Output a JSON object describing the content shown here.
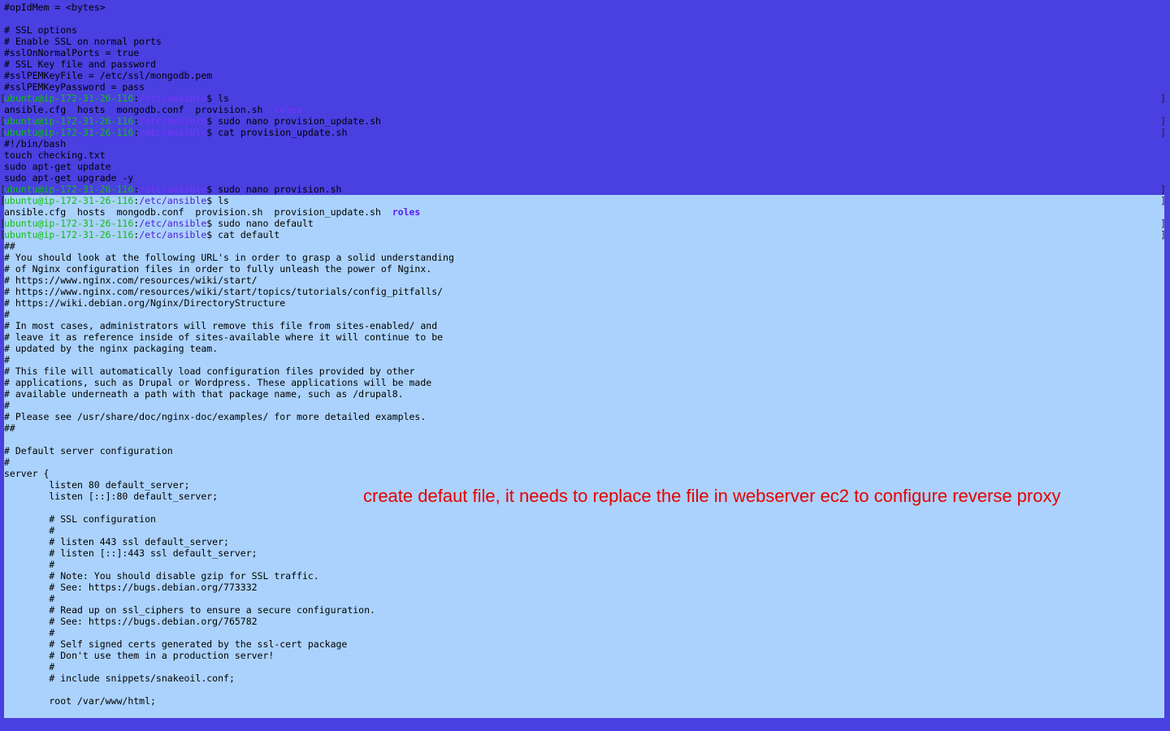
{
  "terminal": {
    "user_host": "ubuntu@ip-172-31-26-116",
    "path": "/etc/ansible",
    "colors": {
      "background": "#4a3fe0",
      "selection": "#abd2fc",
      "prompt_user": "#0fbf12",
      "prompt_path": "#7a33ff",
      "annotation": "#e60000"
    },
    "lines": [
      {
        "type": "text",
        "text": "#opIdMem = <bytes>"
      },
      {
        "type": "text",
        "text": ""
      },
      {
        "type": "text",
        "text": "# SSL options"
      },
      {
        "type": "text",
        "text": "# Enable SSL on normal ports"
      },
      {
        "type": "text",
        "text": "#sslOnNormalPorts = true"
      },
      {
        "type": "text",
        "text": "# SSL Key file and password"
      },
      {
        "type": "text",
        "text": "#sslPEMKeyFile = /etc/ssl/mongodb.pem"
      },
      {
        "type": "text",
        "text": "#sslPEMKeyPassword = pass"
      },
      {
        "type": "prompt",
        "user": "ubuntu@ip-172-31-26-116",
        "path": "/etc/ansible",
        "cmd": "$ ls",
        "selected": false
      },
      {
        "type": "ls",
        "text": "ansible.cfg  hosts  mongodb.conf  provision.sh  ",
        "roles": "roles",
        "selected": false
      },
      {
        "type": "prompt",
        "user": "ubuntu@ip-172-31-26-116",
        "path": "/etc/ansible",
        "cmd": "$ sudo nano provision_update.sh",
        "selected": false
      },
      {
        "type": "prompt",
        "user": "ubuntu@ip-172-31-26-116",
        "path": "/etc/ansible",
        "cmd": "$ cat provision_update.sh",
        "selected": false
      },
      {
        "type": "text",
        "text": "#!/bin/bash"
      },
      {
        "type": "text",
        "text": "touch checking.txt"
      },
      {
        "type": "text",
        "text": "sudo apt-get update"
      },
      {
        "type": "text",
        "text": "sudo apt-get upgrade -y"
      },
      {
        "type": "prompt",
        "user": "ubuntu@ip-172-31-26-116",
        "path": "/etc/ansible",
        "cmd": "$ sudo nano provision.sh",
        "selected": false
      },
      {
        "type": "prompt",
        "user": "ubuntu@ip-172-31-26-116",
        "path": "/etc/ansible",
        "cmd": "$ ls",
        "selected": true
      },
      {
        "type": "ls",
        "text": "ansible.cfg  hosts  mongodb.conf  provision.sh  provision_update.sh  ",
        "roles": "roles",
        "selected": true
      },
      {
        "type": "prompt",
        "user": "ubuntu@ip-172-31-26-116",
        "path": "/etc/ansible",
        "cmd": "$ sudo nano default",
        "selected": true
      },
      {
        "type": "prompt",
        "user": "ubuntu@ip-172-31-26-116",
        "path": "/etc/ansible",
        "cmd": "$ cat default",
        "selected": true
      },
      {
        "type": "text",
        "text": "##"
      },
      {
        "type": "text",
        "text": "# You should look at the following URL's in order to grasp a solid understanding"
      },
      {
        "type": "text",
        "text": "# of Nginx configuration files in order to fully unleash the power of Nginx."
      },
      {
        "type": "text",
        "text": "# https://www.nginx.com/resources/wiki/start/"
      },
      {
        "type": "text",
        "text": "# https://www.nginx.com/resources/wiki/start/topics/tutorials/config_pitfalls/"
      },
      {
        "type": "text",
        "text": "# https://wiki.debian.org/Nginx/DirectoryStructure"
      },
      {
        "type": "text",
        "text": "#"
      },
      {
        "type": "text",
        "text": "# In most cases, administrators will remove this file from sites-enabled/ and"
      },
      {
        "type": "text",
        "text": "# leave it as reference inside of sites-available where it will continue to be"
      },
      {
        "type": "text",
        "text": "# updated by the nginx packaging team."
      },
      {
        "type": "text",
        "text": "#"
      },
      {
        "type": "text",
        "text": "# This file will automatically load configuration files provided by other"
      },
      {
        "type": "text",
        "text": "# applications, such as Drupal or Wordpress. These applications will be made"
      },
      {
        "type": "text",
        "text": "# available underneath a path with that package name, such as /drupal8."
      },
      {
        "type": "text",
        "text": "#"
      },
      {
        "type": "text",
        "text": "# Please see /usr/share/doc/nginx-doc/examples/ for more detailed examples."
      },
      {
        "type": "text",
        "text": "##"
      },
      {
        "type": "text",
        "text": ""
      },
      {
        "type": "text",
        "text": "# Default server configuration"
      },
      {
        "type": "text",
        "text": "#"
      },
      {
        "type": "text",
        "text": "server {"
      },
      {
        "type": "text",
        "text": "        listen 80 default_server;"
      },
      {
        "type": "text",
        "text": "        listen [::]:80 default_server;"
      },
      {
        "type": "text",
        "text": ""
      },
      {
        "type": "text",
        "text": "        # SSL configuration"
      },
      {
        "type": "text",
        "text": "        #"
      },
      {
        "type": "text",
        "text": "        # listen 443 ssl default_server;"
      },
      {
        "type": "text",
        "text": "        # listen [::]:443 ssl default_server;"
      },
      {
        "type": "text",
        "text": "        #"
      },
      {
        "type": "text",
        "text": "        # Note: You should disable gzip for SSL traffic."
      },
      {
        "type": "text",
        "text": "        # See: https://bugs.debian.org/773332"
      },
      {
        "type": "text",
        "text": "        #"
      },
      {
        "type": "text",
        "text": "        # Read up on ssl_ciphers to ensure a secure configuration."
      },
      {
        "type": "text",
        "text": "        # See: https://bugs.debian.org/765782"
      },
      {
        "type": "text",
        "text": "        #"
      },
      {
        "type": "text",
        "text": "        # Self signed certs generated by the ssl-cert package"
      },
      {
        "type": "text",
        "text": "        # Don't use them in a production server!"
      },
      {
        "type": "text",
        "text": "        #"
      },
      {
        "type": "text",
        "text": "        # include snippets/snakeoil.conf;"
      },
      {
        "type": "text",
        "text": ""
      },
      {
        "type": "text",
        "text": "        root /var/www/html;"
      }
    ]
  },
  "annotation": {
    "text": "create  defaut file, it needs to replace the file in webserver ec2 to configure reverse proxy"
  }
}
